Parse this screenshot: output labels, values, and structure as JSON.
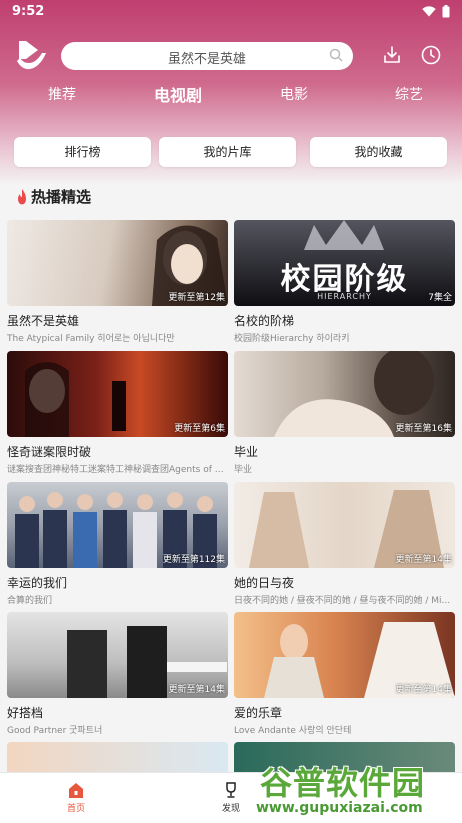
{
  "status_bar": {
    "time": "9:52"
  },
  "search": {
    "text": "虽然不是英雄"
  },
  "tabs": [
    {
      "label": "推荐",
      "active": false
    },
    {
      "label": "电视剧",
      "active": true
    },
    {
      "label": "电影",
      "active": false
    },
    {
      "label": "综艺",
      "active": false
    }
  ],
  "quick_buttons": [
    "排行榜",
    "我的片库",
    "我的收藏"
  ],
  "section": {
    "title": "热播精选"
  },
  "cards": [
    {
      "title": "虽然不是英雄",
      "subtitle": "The Atypical Family 히어로는 아닙니다만",
      "badge": "更新至第12集",
      "colors": [
        "#e8e2dc",
        "#b8a89a"
      ]
    },
    {
      "title": "名校的阶梯",
      "subtitle": "校园阶级Hierarchy 하이라키",
      "badge": "7集全",
      "colors": [
        "#3c3c44",
        "#111114"
      ],
      "overlay_text": "校园阶级",
      "overlay_sub": "HIERARCHY"
    },
    {
      "title": "怪奇谜案限时破",
      "subtitle": "谜案搜查团神秘特工迷案特工神秘调查团Agents of M...",
      "badge": "更新至第6集",
      "colors": [
        "#6a1a18",
        "#2a0808"
      ]
    },
    {
      "title": "毕业",
      "subtitle": "毕业",
      "badge": "更新至第16集",
      "colors": [
        "#d8cfc6",
        "#6e625a"
      ]
    },
    {
      "title": "幸运的我们",
      "subtitle": "合算的我们",
      "badge": "更新至第112集",
      "colors": [
        "#b9bfc8",
        "#3c4660"
      ]
    },
    {
      "title": "她的日与夜",
      "subtitle": "日夜不同的她 / 昼夜不同的她 / 昼与夜不同的她 / Mi...",
      "badge": "更新至第14集",
      "colors": [
        "#f0e9e2",
        "#c4ad98"
      ]
    },
    {
      "title": "好搭档",
      "subtitle": "Good Partner 굿파트너",
      "badge": "更新至第14集",
      "colors": [
        "#d6d6d6",
        "#3a3a3a"
      ]
    },
    {
      "title": "爱的乐章",
      "subtitle": "Love Andante 사랑의 안단테",
      "badge": "更新至第14集",
      "colors": [
        "#e8a36a",
        "#7a3a24"
      ]
    }
  ],
  "bottom_nav": [
    {
      "label": "首页",
      "active": true
    },
    {
      "label": "发现",
      "active": false
    }
  ],
  "watermark": {
    "title": "谷普软件园",
    "url": "www.gupuxiazai.com"
  },
  "colors": {
    "header_gradient_top": "#bf3f6f",
    "accent": "#e8563e",
    "flame": "#ea4b4b"
  }
}
